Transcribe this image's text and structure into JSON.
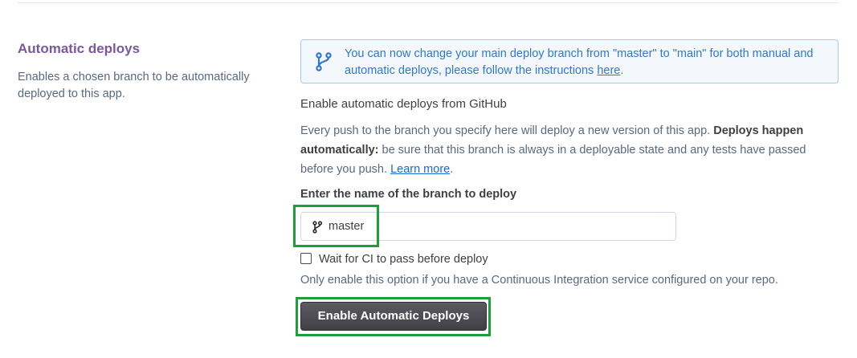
{
  "section": {
    "title": "Automatic deploys",
    "description": "Enables a chosen branch to be automatically deployed to this app."
  },
  "notice": {
    "icon": "branch-icon",
    "text": "You can now change your main deploy branch from \"master\" to \"main\" for both manual and automatic deploys, please follow the instructions ",
    "link_text": "here",
    "suffix": ".",
    "color": "#2f78d2"
  },
  "auto_deploy": {
    "heading": "Enable automatic deploys from GitHub",
    "body_prefix": "Every push to the branch you specify here will deploy a new version of this app. ",
    "body_bold": "Deploys happen automatically:",
    "body_rest": " be sure that this branch is always in a deployable state and any tests have passed before you push. ",
    "learn_more": "Learn more",
    "body_suffix": ".",
    "branch_label": "Enter the name of the branch to deploy",
    "branch_value": "master",
    "ci_checkbox_label": "Wait for CI to pass before deploy",
    "ci_checked": false,
    "ci_help": "Only enable this option if you have a Continuous Integration service configured on your repo.",
    "button_label": "Enable Automatic Deploys"
  },
  "colors": {
    "title_purple": "#79589f",
    "highlight_green": "#1e9e3a",
    "button_dark": "#4a4a50"
  }
}
